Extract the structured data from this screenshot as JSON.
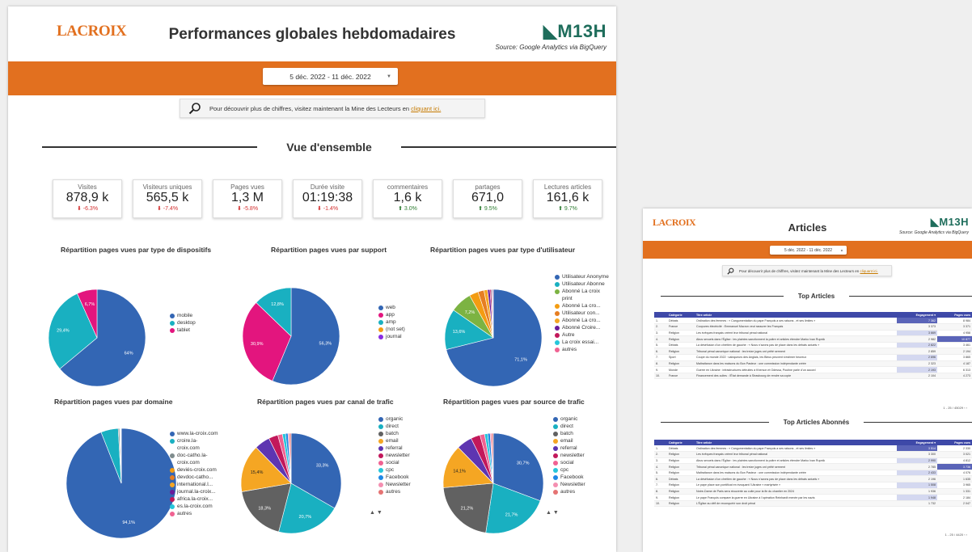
{
  "left": {
    "logo": "LACROIX",
    "title": "Performances globales hebdomadaires",
    "brand": "M13H",
    "source": "Source: Google Analytics via BigQuery",
    "date_range": "5 déc. 2022 - 11 déc. 2022",
    "banner": {
      "text": "Pour découvrir plus de chiffres, visitez maintenant la Mine des Lecteurs en",
      "link": "cliquant ici."
    },
    "section_title": "Vue d'ensemble",
    "kpis": [
      {
        "label": "Visites",
        "value": "878,9 k",
        "delta": "-6.3%",
        "trend": "down"
      },
      {
        "label": "Visiteurs uniques",
        "value": "565,5 k",
        "delta": "-7.4%",
        "trend": "down"
      },
      {
        "label": "Pages vues",
        "value": "1,3 M",
        "delta": "-5.8%",
        "trend": "down"
      },
      {
        "label": "Durée visite",
        "value": "01:19:38",
        "delta": "-1.4%",
        "trend": "down"
      },
      {
        "label": "commentaires",
        "value": "1,6 k",
        "delta": "3.0%",
        "trend": "up"
      },
      {
        "label": "partages",
        "value": "671,0",
        "delta": "9.5%",
        "trend": "up"
      },
      {
        "label": "Lectures articles",
        "value": "161,6 k",
        "delta": "9.7%",
        "trend": "up"
      }
    ],
    "pager_arrows": "▲ ▼"
  },
  "chart_data": [
    {
      "type": "pie",
      "title": "Répartition pages vues par type de dispositifs",
      "labels": [
        "mobile",
        "desktop",
        "tablet"
      ],
      "values": [
        64,
        29.4,
        6.7
      ],
      "slice_labels": [
        "64%",
        "29,4%",
        "6,7%"
      ],
      "colors": [
        "#3366b4",
        "#19b0c1",
        "#e3157e"
      ]
    },
    {
      "type": "pie",
      "title": "Répartition pages vues par support",
      "labels": [
        "web",
        "app",
        "amp",
        "(not set)",
        "journal"
      ],
      "values": [
        56.3,
        30.9,
        12.8,
        0,
        0
      ],
      "slice_labels": [
        "56,3%",
        "30,9%",
        "12,8%",
        "",
        ""
      ],
      "colors": [
        "#3366b4",
        "#e3157e",
        "#19b0c1",
        "#f39c12",
        "#8a2be2"
      ]
    },
    {
      "type": "pie",
      "title": "Répartition pages vues par type d'utilisateur",
      "labels": [
        "Utilisateur Anonyme",
        "Utilisateur Abonne",
        "Abonné La croix print",
        "Abonné La cro...",
        "Utilisateur con...",
        "Abonné La cro...",
        "Abonné Croire...",
        "Autre",
        "La croix essai...",
        "autres"
      ],
      "values": [
        71.1,
        13.6,
        7.2,
        3,
        2,
        1.2,
        0.8,
        0.5,
        0.3,
        0.3
      ],
      "slice_labels": [
        "71,1%",
        "13,6%",
        "7,2%",
        "",
        "",
        "",
        "",
        "",
        "",
        ""
      ],
      "colors": [
        "#3366b4",
        "#19b0c1",
        "#7cb342",
        "#f39c12",
        "#e67e22",
        "#f5a623",
        "#6a1b9a",
        "#c2185b",
        "#26c6da",
        "#f06292"
      ]
    },
    {
      "type": "pie",
      "title": "Répartition pages vues par domaine",
      "labels": [
        "www.la-croix.com",
        "croire.la-croix.com",
        "doc-catho.la-croix.com",
        "deviés-croix.com",
        "devdoc-catho...",
        "international.l...",
        "journal.la-croix...",
        "africa.la-croix...",
        "es.la-croix.com",
        "autres"
      ],
      "values": [
        94.1,
        5.1,
        0.4,
        0.1,
        0.1,
        0.1,
        0.05,
        0.05,
        0.05,
        0.05
      ],
      "slice_labels": [
        "94,1%",
        "",
        "",
        "",
        "",
        "",
        "",
        "",
        "",
        ""
      ],
      "colors": [
        "#3366b4",
        "#19b0c1",
        "#7f8c8d",
        "#f39c12",
        "#e67e22",
        "#f5a623",
        "#6a1b9a",
        "#c2185b",
        "#26c6da",
        "#f06292"
      ]
    },
    {
      "type": "pie",
      "title": "Répartition pages vues par canal de trafic",
      "labels": [
        "organic",
        "direct",
        "batch",
        "email",
        "referral",
        "newsletter",
        "social",
        "cpc",
        "Facebook",
        "Newsletter",
        "autres"
      ],
      "values": [
        33.3,
        20.7,
        18.3,
        15.4,
        5,
        3,
        1.5,
        1,
        0.8,
        0.5,
        0.5
      ],
      "slice_labels": [
        "33,3%",
        "20,7%",
        "18,3%",
        "15,4%",
        "",
        "",
        "",
        "",
        "",
        "",
        ""
      ],
      "colors": [
        "#3366b4",
        "#19b0c1",
        "#616161",
        "#f5a623",
        "#5e35b1",
        "#c2185b",
        "#f06292",
        "#26c6da",
        "#1e88e5",
        "#f48fb1",
        "#e57373"
      ]
    },
    {
      "type": "pie",
      "title": "Répartition pages vues par source de trafic",
      "labels": [
        "organic",
        "direct",
        "batch",
        "email",
        "referral",
        "newsletter",
        "social",
        "cpc",
        "Facebook",
        "Newsletter",
        "autres"
      ],
      "values": [
        30.7,
        21.7,
        21.2,
        14.1,
        5,
        3,
        1.5,
        1,
        0.8,
        0.5,
        0.5
      ],
      "slice_labels": [
        "30,7%",
        "21,7%",
        "21,2%",
        "14,1%",
        "",
        "",
        "",
        "",
        "",
        "",
        ""
      ],
      "colors": [
        "#3366b4",
        "#19b0c1",
        "#616161",
        "#f5a623",
        "#5e35b1",
        "#c2185b",
        "#f06292",
        "#26c6da",
        "#1e88e5",
        "#f48fb1",
        "#e57373"
      ]
    }
  ],
  "right": {
    "logo": "LACROIX",
    "title": "Articles",
    "brand": "M13H",
    "source": "Source: Google Analytics via BigQuery",
    "date_range": "5 déc. 2022 - 11 déc. 2022",
    "banner": {
      "text": "Pour découvrir plus de chiffres, visitez maintenant la Mine des Lecteurs en",
      "link": "cliquant ici."
    },
    "top_articles_title": "Top Articles",
    "top_abonnes_title": "Top Articles Abonnés",
    "columns": [
      "",
      "Catégorie",
      "Titre article",
      "Engagement ▾",
      "Pages vues"
    ],
    "top_articles": [
      [
        "1.",
        "Débats",
        "Ordination des femmes : « Cangumentation du pape François a ses raisons , et ses limites »",
        "7 362",
        "8 984"
      ],
      [
        "2.",
        "France",
        "Coopures électricité : Emmanuel Macron veut rassurer les Français",
        "3 373",
        "3 371"
      ],
      [
        "3.",
        "Religion",
        "Les évêques français créent leur tribunal pénal national",
        "3 669",
        "4 958"
      ],
      [
        "4.",
        "Religion",
        "Abus sexuels dans l'Église : les plaintes sanctionnent la poitre et articles étendre Marko Ivan Rupnik",
        "2 982",
        "10 877"
      ],
      [
        "5.",
        "Débats",
        "La déséfusion d'un chrétien de gauche : « Nous n'avons pas de place dans les débats actuels »",
        "2 822",
        "3 461"
      ],
      [
        "6.",
        "Religion",
        "Tribunal pénal canonique national : les treize juges ont prêté serment",
        "2 859",
        "2 194"
      ],
      [
        "7.",
        "Sport",
        "Coupe du monde 2022 : vainqueurs des Anglais, les Bleus peuvent s'estimer heureux",
        "2 696",
        "3 865"
      ],
      [
        "8.",
        "Religion",
        "Maltraitance dans les maisons du Bon Pasteur : une commission indépendante créée",
        "2 323",
        "4 187"
      ],
      [
        "9.",
        "Monde",
        "Guerre en Ukraine : infrastructures détruites à Kherson et Odessa, Poutine parle d'un accord",
        "2 193",
        "6 313"
      ],
      [
        "10.",
        "France",
        "Financement des cultes : l'État demande à Strasbourg de rendre sa copie",
        "2 104",
        "4 273"
      ]
    ],
    "top_abonnes": [
      [
        "1.",
        "Débats",
        "Ordination des femmes : « Cangumentation du pape François a ses raisons , et ses limites »",
        "3 514",
        "2 330"
      ],
      [
        "2.",
        "Religion",
        "Les évêques français créent leur tribunal pénal national",
        "3 300",
        "3 021"
      ],
      [
        "3.",
        "Religion",
        "Abus sexuels dans l'Église : les plaintes sanctionnent la poitre et articles étendre Marko Ivan Rupnik",
        "2 990",
        "4 812"
      ],
      [
        "4.",
        "Religion",
        "Tribunal pénal canonique national : les treize juges ont prêté serment",
        "2 785",
        "3 736"
      ],
      [
        "5.",
        "Religion",
        "Maltraitance dans les maisons du Bon Pasteur : une commission indépendante créée",
        "2 433",
        "4 076"
      ],
      [
        "6.",
        "Débats",
        "La déséfusion d'un chrétien de gauche : « Nous n'avons pas de place dans les débats actuels »",
        "2 196",
        "1 635"
      ],
      [
        "7.",
        "Religion",
        "Le pape place son pontificat en évoquant l'Ukraine « martyrisée »",
        "1 508",
        "3 965"
      ],
      [
        "8.",
        "Religion",
        "Notre-Dame de Paris sera réouverte au culte pour la fin du chantier en 2024",
        "1 936",
        "1 331"
      ],
      [
        "9.",
        "Religion",
        "Le pape François compare la guerre en Ukraine à l'opération Reinhardt menée par les nazis",
        "1 948",
        "2 184"
      ],
      [
        "10.",
        "Religion",
        "L'Église au défi de reconquérir son droit pénal",
        "1 732",
        "2 047"
      ]
    ],
    "pager1": "1 - 25 / 45029 ‹ ›",
    "pager2": "1 - 25 / 4420 ‹ ›"
  }
}
